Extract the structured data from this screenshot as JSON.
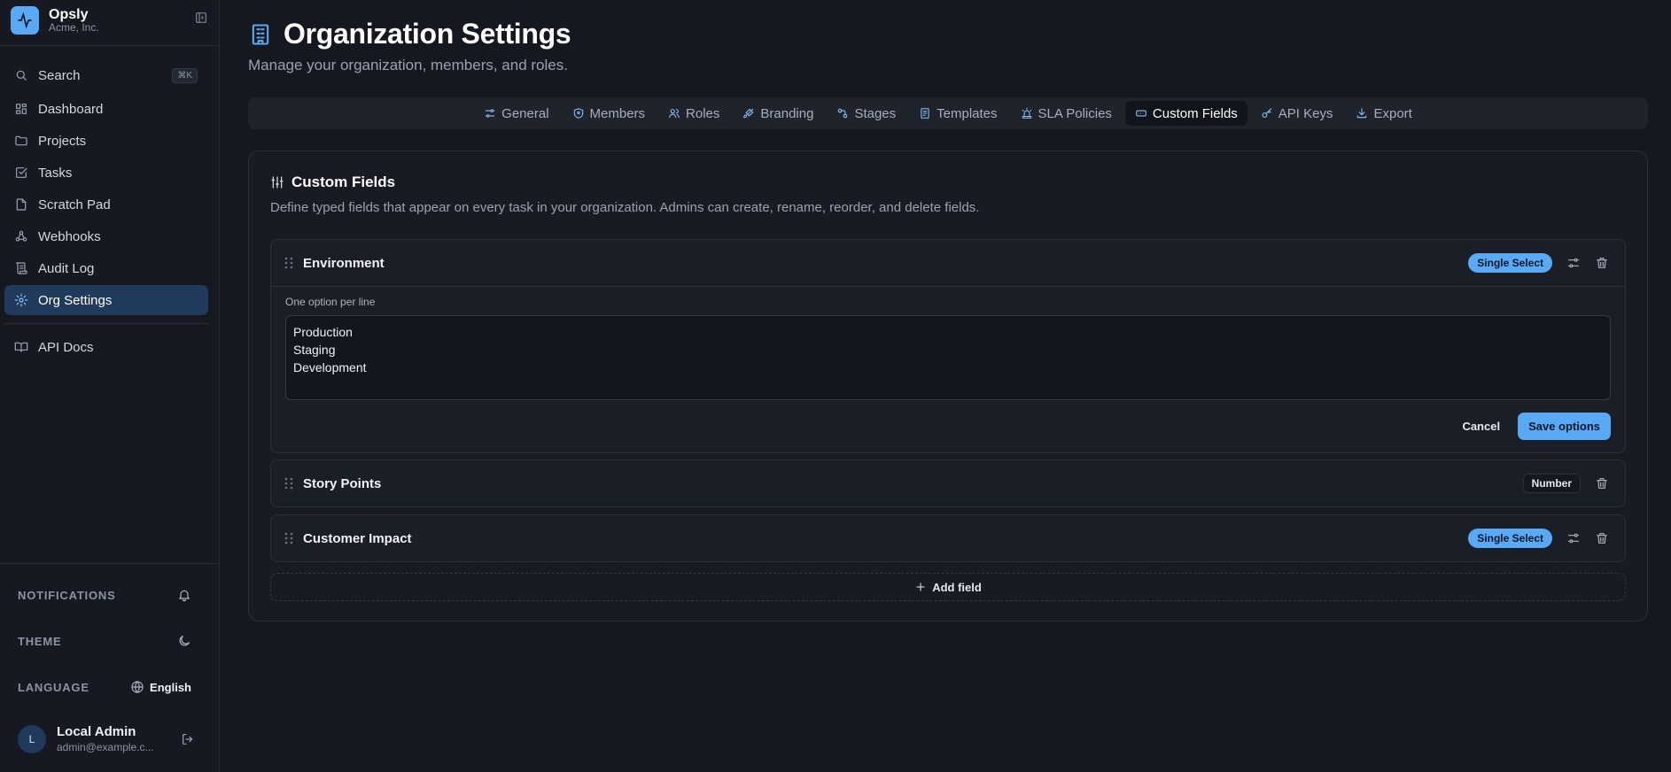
{
  "brand": {
    "name": "Opsly",
    "org": "Acme, Inc."
  },
  "sidebar": {
    "search": {
      "label": "Search",
      "shortcut": "⌘K"
    },
    "items": [
      {
        "label": "Dashboard",
        "icon": "dashboard-icon"
      },
      {
        "label": "Projects",
        "icon": "folder-icon"
      },
      {
        "label": "Tasks",
        "icon": "check-square-icon"
      },
      {
        "label": "Scratch Pad",
        "icon": "file-icon"
      },
      {
        "label": "Webhooks",
        "icon": "webhook-icon"
      },
      {
        "label": "Audit Log",
        "icon": "scroll-icon"
      },
      {
        "label": "Org Settings",
        "icon": "gear-icon",
        "active": true
      },
      {
        "label": "API Docs",
        "icon": "book-icon"
      }
    ],
    "notifications_label": "NOTIFICATIONS",
    "theme_label": "THEME",
    "language_label": "LANGUAGE",
    "language_value": "English",
    "user": {
      "initial": "L",
      "name": "Local Admin",
      "email": "admin@example.c..."
    }
  },
  "page": {
    "title": "Organization Settings",
    "subtitle": "Manage your organization, members, and roles."
  },
  "tabs": [
    {
      "label": "General",
      "icon": "sliders-icon"
    },
    {
      "label": "Members",
      "icon": "shield-icon"
    },
    {
      "label": "Roles",
      "icon": "users-icon"
    },
    {
      "label": "Branding",
      "icon": "brush-icon"
    },
    {
      "label": "Stages",
      "icon": "workflow-icon"
    },
    {
      "label": "Templates",
      "icon": "template-icon"
    },
    {
      "label": "SLA Policies",
      "icon": "siren-icon"
    },
    {
      "label": "Custom Fields",
      "icon": "input-icon",
      "active": true
    },
    {
      "label": "API Keys",
      "icon": "key-icon"
    },
    {
      "label": "Export",
      "icon": "download-icon"
    }
  ],
  "custom_fields": {
    "title": "Custom Fields",
    "description": "Define typed fields that appear on every task in your organization. Admins can create, rename, reorder, and delete fields.",
    "fields": [
      {
        "name": "Environment",
        "type": "Single Select"
      },
      {
        "name": "Story Points",
        "type": "Number"
      },
      {
        "name": "Customer Impact",
        "type": "Single Select"
      }
    ],
    "editor": {
      "label": "One option per line",
      "options": [
        "Production",
        "Staging",
        "Development"
      ],
      "cancel_label": "Cancel",
      "save_label": "Save options"
    },
    "add_label": "Add field"
  },
  "colors": {
    "accent": "#5aa9f5",
    "background": "#151821",
    "sidebar": "#161922",
    "active_nav": "#1f3a5a"
  }
}
